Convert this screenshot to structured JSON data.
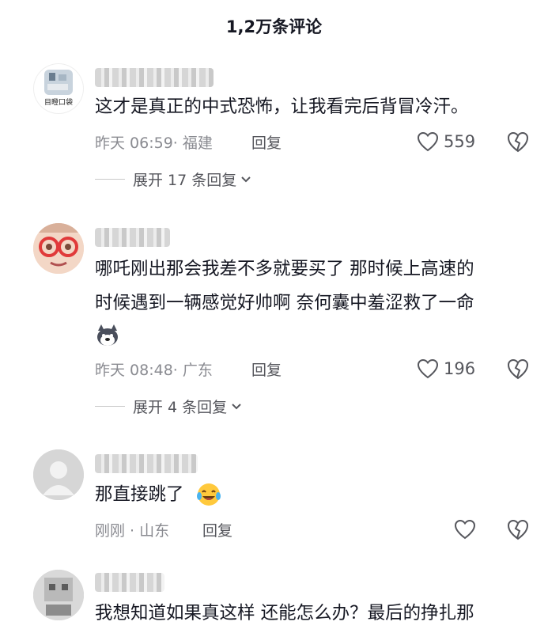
{
  "header": {
    "title": "1,2万条评论"
  },
  "comments": [
    {
      "username": "",
      "avatar_label": "目瞪口袋",
      "lines": [
        "这才是真正的中式恐怖，让我看完后背冒冷汗。"
      ],
      "meta": "昨天 06:59· 福建",
      "reply": "回复",
      "likes": "559",
      "expand": "展开 17 条回复"
    },
    {
      "username": "",
      "lines": [
        "哪吒刚出那会我差不多就要买了 那时候上高速的",
        "时候遇到一辆感觉好帅啊 奈何囊中羞涩救了一命"
      ],
      "meta": "昨天 08:48· 广东",
      "reply": "回复",
      "likes": "196",
      "expand": "展开 4 条回复"
    },
    {
      "username": "",
      "lines": [
        "那直接跳了"
      ],
      "meta": "刚刚 · 山东",
      "reply": "回复",
      "likes": ""
    },
    {
      "username": "",
      "lines": [
        "我想知道如果真这样 还能怎么办？最后的挣扎那"
      ]
    }
  ],
  "icons": [
    "heart-outline-icon",
    "broken-heart-icon",
    "chevron-down-icon",
    "husky-emoji",
    "laughing-tears-emoji"
  ]
}
